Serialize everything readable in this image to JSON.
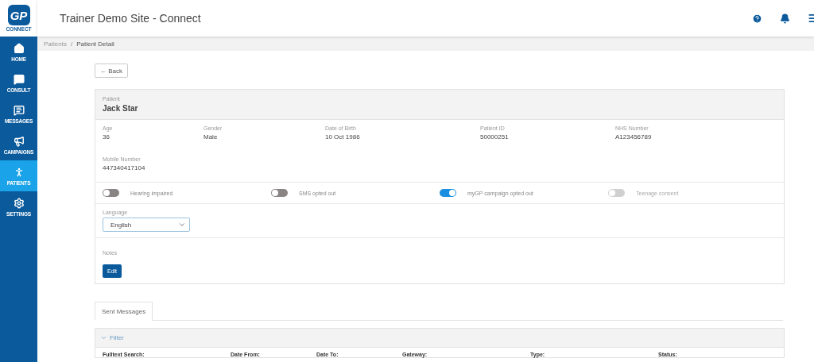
{
  "logo": {
    "mark": "GP",
    "caption": "CONNECT"
  },
  "header": {
    "title": "Trainer Demo Site - Connect"
  },
  "sidebar": {
    "items": [
      {
        "kind": "home",
        "label": "HOME",
        "selected": false
      },
      {
        "kind": "consult",
        "label": "CONSULT",
        "selected": false
      },
      {
        "kind": "messages",
        "label": "MESSAGES",
        "selected": false
      },
      {
        "kind": "campaigns",
        "label": "CAMPAIGNS",
        "selected": false
      },
      {
        "kind": "patients",
        "label": "PATIENTS",
        "selected": true
      },
      {
        "kind": "settings",
        "label": "SETTINGS",
        "selected": false
      }
    ]
  },
  "breadcrumb": {
    "separator": "/",
    "items": [
      "Patients",
      "Patient Detail"
    ]
  },
  "back_button": "← Back",
  "patient": {
    "label": "Patient",
    "name": "Jack Star",
    "fields": [
      {
        "label": "Age",
        "value": "36"
      },
      {
        "label": "Gender",
        "value": "Male"
      },
      {
        "label": "Date of Birth",
        "value": "10 Oct 1986"
      },
      {
        "label": "Patient ID",
        "value": "50000251"
      },
      {
        "label": "NHS Number",
        "value": "A123456789"
      }
    ],
    "mobile": {
      "label": "Mobile Number",
      "value": "447340417104"
    },
    "toggles": [
      {
        "label": "Hearing impaired",
        "on": false,
        "disabled": false
      },
      {
        "label": "SMS opted out",
        "on": false,
        "disabled": false
      },
      {
        "label": "myGP campaign opted out",
        "on": true,
        "disabled": false
      },
      {
        "label": "Teenage consent",
        "on": false,
        "disabled": true
      }
    ],
    "language": {
      "label": "Language",
      "value": "English"
    },
    "notes": {
      "label": "Notes",
      "button": "Edit"
    }
  },
  "tabs": [
    {
      "label": "Sent Messages",
      "selected": true
    }
  ],
  "filter": {
    "title": "Filter",
    "expanded": true,
    "columns": [
      "Fulltext Search:",
      "Date From:",
      "Date To:",
      "Gateway:",
      "Type:",
      "Status:"
    ]
  }
}
